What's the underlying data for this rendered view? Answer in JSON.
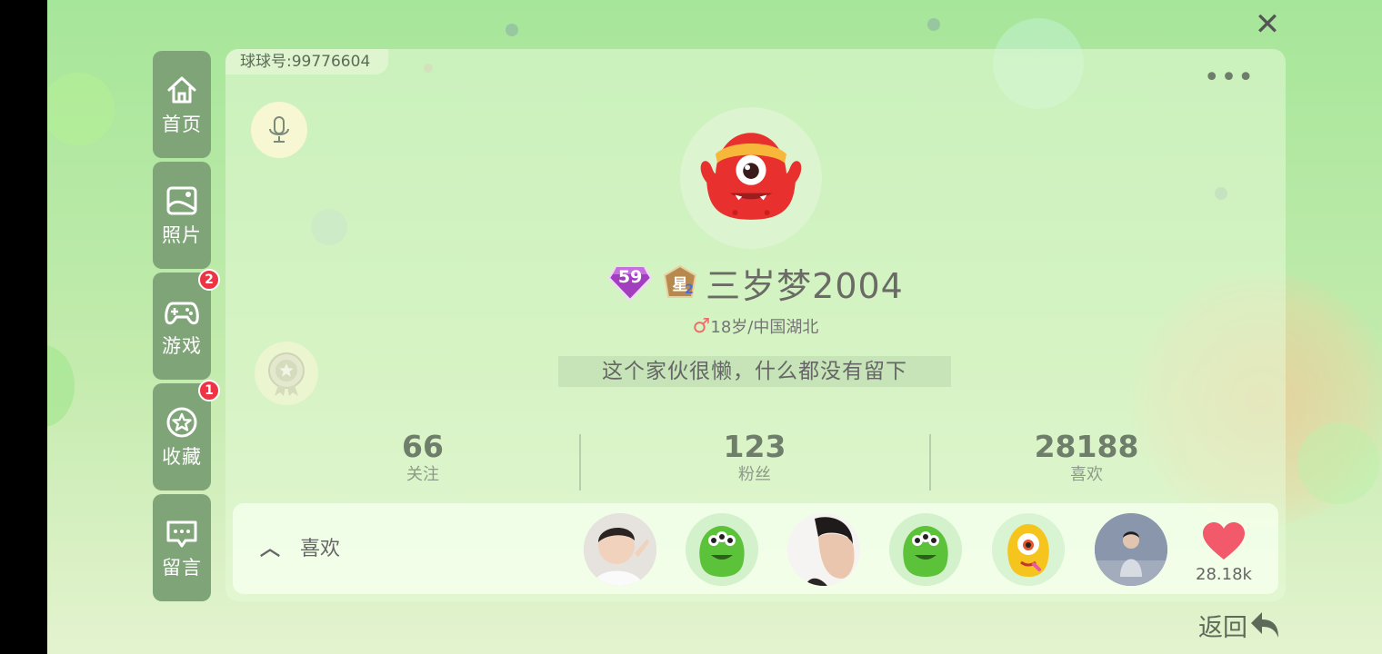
{
  "nav": {
    "items": [
      {
        "label": "首页",
        "icon": "home-icon"
      },
      {
        "label": "照片",
        "icon": "photo-icon"
      },
      {
        "label": "游戏",
        "icon": "gamepad-icon",
        "badge": "2"
      },
      {
        "label": "收藏",
        "icon": "star-icon",
        "badge": "1"
      },
      {
        "label": "留言",
        "icon": "message-icon"
      }
    ]
  },
  "profile": {
    "uid_text": "球球号:99776604",
    "level": "59",
    "star_rank": "2",
    "username": "三岁梦2004",
    "gender_symbol": "♂",
    "info": "18岁/中国湖北",
    "signature": "这个家伙很懒，什么都没有留下"
  },
  "stats": [
    {
      "value": "66",
      "label": "关注"
    },
    {
      "value": "123",
      "label": "粉丝"
    },
    {
      "value": "28188",
      "label": "喜欢"
    }
  ],
  "likes": {
    "toggle_label": "喜欢",
    "count": "28.18k"
  },
  "actions": {
    "close": "✕",
    "more": "•••",
    "back_label": "返回"
  },
  "colors": {
    "nav_bg": "#7fa478",
    "badge": "#ee3344",
    "heart": "#f25a6b"
  }
}
